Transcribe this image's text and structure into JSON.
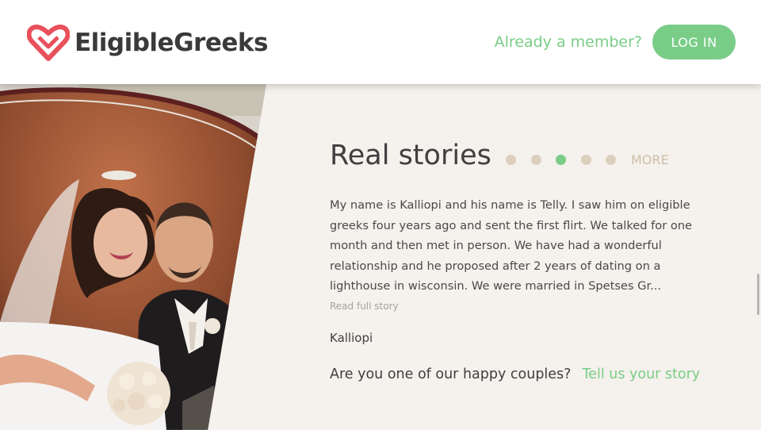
{
  "header": {
    "logo_text": "EligibleGreeks",
    "member_prompt": "Already a member?",
    "login_label": "LOG IN"
  },
  "stories": {
    "title": "Real stories",
    "carousel": {
      "total": 5,
      "active_index": 2
    },
    "more_label": "MORE",
    "story_text": "My name is Kalliopi and his name is Telly. I saw him on eligible greeks four years ago and sent the first flirt. We talked for one month and then met in person. We have had a wonderful relationship and he proposed after 2 years of dating on a lighthouse in wisconsin. We were married in Spetses Gr...",
    "read_full_label": "Read full story",
    "author": "Kalliopi",
    "cta_question": "Are you one of our happy couples?",
    "cta_link": "Tell us your story"
  },
  "colors": {
    "accent": "#79cd87",
    "logo_heart": "#e8505b",
    "section_bg": "#f5f1ec",
    "dot_inactive": "#dccfbd"
  }
}
